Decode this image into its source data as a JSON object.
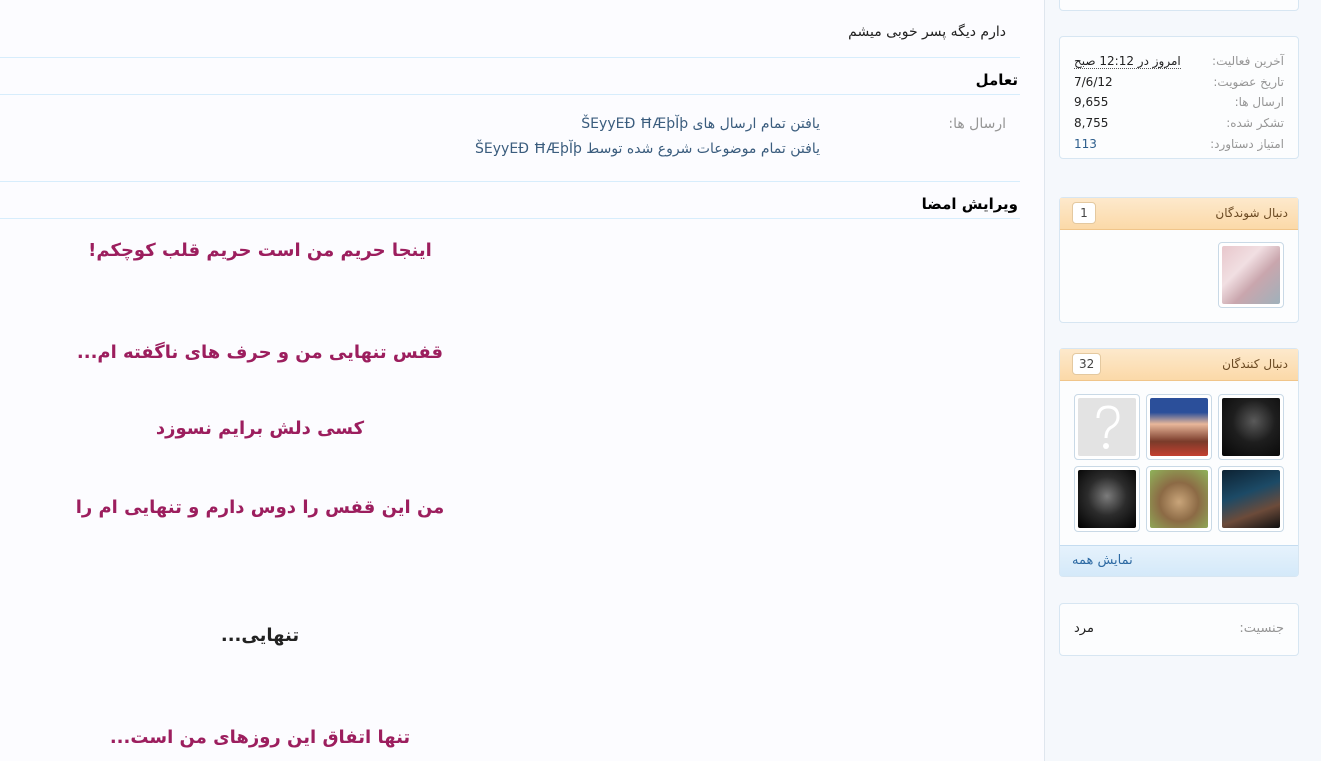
{
  "main": {
    "bio_line": "دارم دیگه پسر خوبی میشم",
    "interaction": {
      "title": "تعامل",
      "posts_label": "ارسال ها:",
      "links": [
        "یافتن تمام ارسال های ŠEyyEÐ ĦÆþĬþ",
        "یافتن تمام موضوعات شروع شده توسط ŠEyyEÐ ĦÆþĬþ"
      ]
    },
    "signature": {
      "title": "ویرایش امضا",
      "lines": [
        "اینجا حریم من است حریم قلب کوچکم!",
        "قفس تنهایی من و حرف های ناگفته ام...",
        "کسی دلش برایم نسوزد",
        "من این قفس را دوس دارم و تنهایی ام را",
        "تنهایی...",
        "تنها اتفاق این روزهای من است..."
      ]
    }
  },
  "sidebar": {
    "stats": [
      {
        "label": "آخرین فعالیت:",
        "value": "امروز در 12:12 صبح"
      },
      {
        "label": "تاریخ عضویت:",
        "value": "7/6/12"
      },
      {
        "label": "ارسال ها:",
        "value": "9,655"
      },
      {
        "label": "تشکر شده:",
        "value": "8,755"
      },
      {
        "label": "امتیاز دستاورد:",
        "value": "113"
      }
    ],
    "following": {
      "title": "دنبال شوندگان",
      "count": "1"
    },
    "followers": {
      "title": "دنبال کنندگان",
      "count": "32",
      "show_all": "نمایش همه"
    },
    "gender": {
      "label": "جنسیت:",
      "value": "مرد"
    }
  }
}
